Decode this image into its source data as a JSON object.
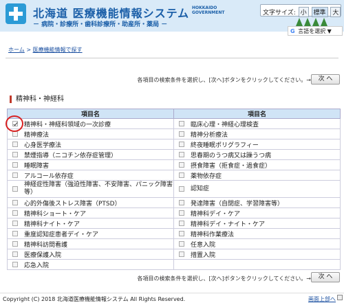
{
  "header": {
    "title": "北海道 医療機能情報システム",
    "gov_line1": "HOKKAIDO",
    "gov_line2": "GOVERNMENT",
    "subtitle": "－ 病院・診療所・歯科診療所・助産所・薬局 －",
    "font_size_label": "文字サイズ:",
    "font_sizes": [
      "小",
      "標準",
      "大"
    ],
    "translate_label": "言語を選択",
    "translate_arrow": "▼",
    "icons": [
      "plus-cross-logo",
      "tree-icons",
      "google-g-icon"
    ]
  },
  "breadcrumb": {
    "home": "ホーム",
    "sep": ">",
    "current": "医療機能情報で探す"
  },
  "instruction": "各項目の検索条件を選択し、[次へ]ボタンをクリックしてください。→",
  "next_label": "次 へ",
  "section_title": "精神科・神経科",
  "table": {
    "header_left": "項目名",
    "header_right": "項目名",
    "left": [
      {
        "label": "精神科・神経科領域の一次診療",
        "checked": true
      },
      {
        "label": "精神療法",
        "checked": false
      },
      {
        "label": "心身医学療法",
        "checked": false
      },
      {
        "label": "禁煙指導（ニコチン依存症管理）",
        "checked": false
      },
      {
        "label": "睡眠障害",
        "checked": false
      },
      {
        "label": "アルコール依存症",
        "checked": false
      },
      {
        "label": "神経症性障害（強迫性障害、不安障害、パニック障害等）",
        "checked": false
      },
      {
        "label": "心的外傷後ストレス障害（PTSD）",
        "checked": false
      },
      {
        "label": "精神科ショート・ケア",
        "checked": false
      },
      {
        "label": "精神科ナイト・ケア",
        "checked": false
      },
      {
        "label": "重度認知症患者デイ・ケア",
        "checked": false
      },
      {
        "label": "精神科訪問看護",
        "checked": false
      },
      {
        "label": "医療保護入院",
        "checked": false
      },
      {
        "label": "応急入院",
        "checked": false
      }
    ],
    "right": [
      {
        "label": "臨床心理・神経心理検査",
        "checked": false
      },
      {
        "label": "精神分析療法",
        "checked": false
      },
      {
        "label": "終夜睡眠ポリグラフィー",
        "checked": false
      },
      {
        "label": "思春期のうつ病又は躁うつ病",
        "checked": false
      },
      {
        "label": "摂食障害（拒食症・過食症）",
        "checked": false
      },
      {
        "label": "薬物依存症",
        "checked": false
      },
      {
        "label": "認知症",
        "checked": false
      },
      {
        "label": "発達障害（自閉症、学習障害等）",
        "checked": false
      },
      {
        "label": "精神科デイ・ケア",
        "checked": false
      },
      {
        "label": "精神科デイ・ナイト・ケア",
        "checked": false
      },
      {
        "label": "精神科作業療法",
        "checked": false
      },
      {
        "label": "任意入院",
        "checked": false
      },
      {
        "label": "措置入院",
        "checked": false
      }
    ]
  },
  "footer": {
    "copyright": "Copyright (C) 2018 北海道医療機能情報システム All Rights Reserved.",
    "top_link": "画面上部へ"
  }
}
